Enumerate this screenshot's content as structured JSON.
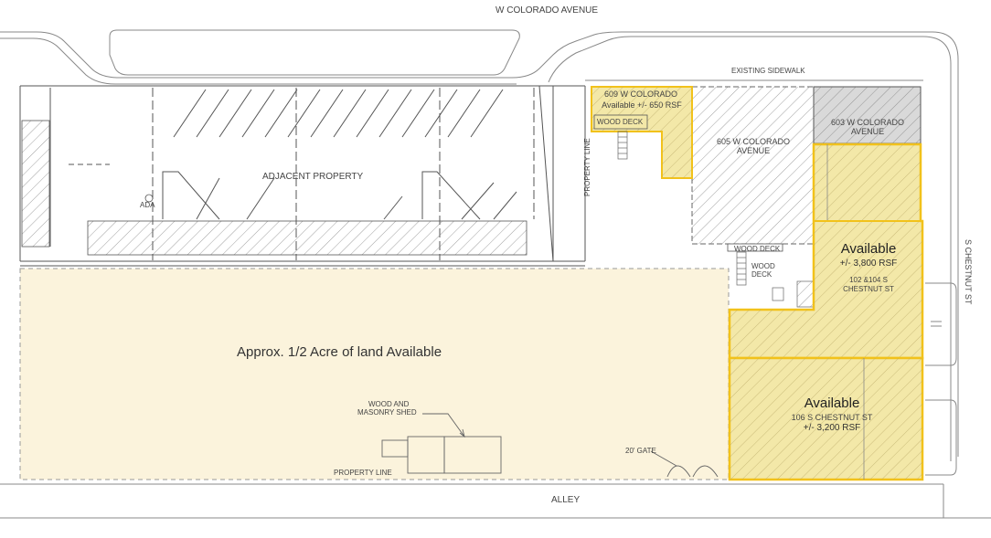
{
  "streets": {
    "north": "W COLORADO AVENUE",
    "east": "S CHESTNUT ST",
    "south": "ALLEY"
  },
  "labels": {
    "existing_sidewalk": "EXISTING SIDEWALK",
    "adjacent_property": "ADJACENT PROPERTY",
    "ada": "ADA",
    "property_line_vertical": "PROPERTY LINE",
    "property_line_bottom": "PROPERTY LINE",
    "wood_deck_top": "WOOD DECK",
    "wood_deck_middle": "WOOD DECK",
    "wood_deck_small_line1": "WOOD",
    "wood_deck_small_line2": "DECK",
    "shed_line1": "WOOD AND",
    "shed_line2": "MASONRY SHED",
    "gate": "20' GATE"
  },
  "land": {
    "text": "Approx. 1/2 Acre of land Available"
  },
  "units": [
    {
      "address": "609 W COLORADO",
      "status_size": "Available +/- 650 RSF",
      "available": true
    },
    {
      "address_line1": "605 W COLORADO",
      "address_line2": "AVENUE",
      "available": false
    },
    {
      "address_line1": "603 W COLORADO",
      "address_line2": "AVENUE",
      "available": false
    },
    {
      "status": "Available",
      "size": "+/- 3,800 RSF",
      "address_line1": "102 &104 S",
      "address_line2": "CHESTNUT ST",
      "available": true
    },
    {
      "status": "Available",
      "address": "106 S CHESTNUT ST",
      "size": "+/- 3,200 RSF",
      "available": true
    }
  ],
  "colors": {
    "available_fill": "#f3e8a8",
    "available_outline": "#f2c21a",
    "land_fill": "#fbf3dc",
    "occupied_fill": "#d9d9d9",
    "line": "#555555"
  }
}
